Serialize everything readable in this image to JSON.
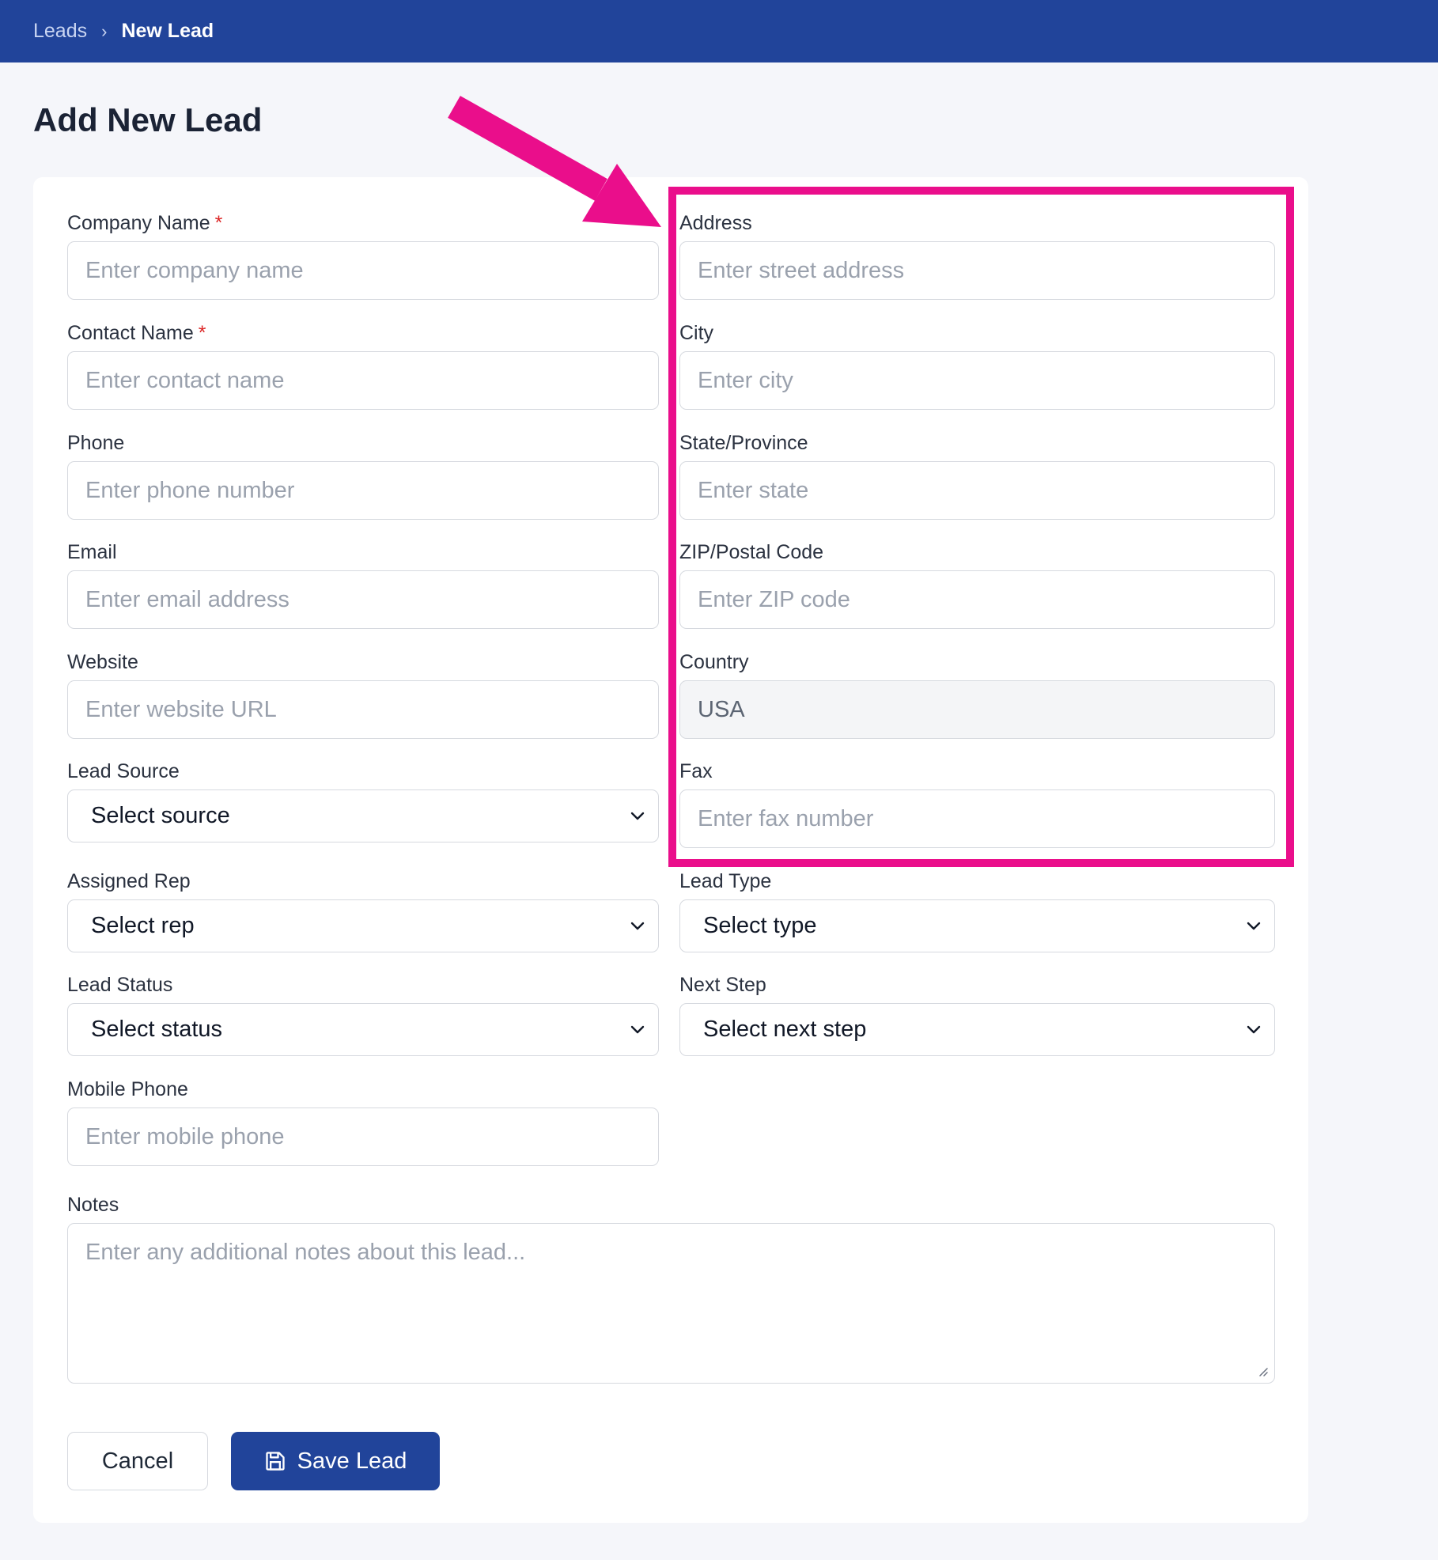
{
  "breadcrumb": {
    "parent": "Leads",
    "separator": "›",
    "current": "New Lead"
  },
  "page_title": "Add New Lead",
  "required_marker": "*",
  "left": {
    "company_name": {
      "label": "Company Name",
      "placeholder": "Enter company name"
    },
    "contact_name": {
      "label": "Contact Name",
      "placeholder": "Enter contact name"
    },
    "phone": {
      "label": "Phone",
      "placeholder": "Enter phone number"
    },
    "email": {
      "label": "Email",
      "placeholder": "Enter email address"
    },
    "website": {
      "label": "Website",
      "placeholder": "Enter website URL"
    },
    "lead_source": {
      "label": "Lead Source",
      "value": "Select source"
    },
    "assigned_rep": {
      "label": "Assigned Rep",
      "value": "Select rep"
    },
    "lead_status": {
      "label": "Lead Status",
      "value": "Select status"
    },
    "mobile_phone": {
      "label": "Mobile Phone",
      "placeholder": "Enter mobile phone"
    }
  },
  "right": {
    "address": {
      "label": "Address",
      "placeholder": "Enter street address"
    },
    "city": {
      "label": "City",
      "placeholder": "Enter city"
    },
    "state": {
      "label": "State/Province",
      "placeholder": "Enter state"
    },
    "zip": {
      "label": "ZIP/Postal Code",
      "placeholder": "Enter ZIP code"
    },
    "country": {
      "label": "Country",
      "value": "USA"
    },
    "fax": {
      "label": "Fax",
      "placeholder": "Enter fax number"
    },
    "lead_type": {
      "label": "Lead Type",
      "value": "Select type"
    },
    "next_step": {
      "label": "Next Step",
      "value": "Select next step"
    }
  },
  "notes": {
    "label": "Notes",
    "placeholder": "Enter any additional notes about this lead..."
  },
  "actions": {
    "cancel": "Cancel",
    "save": "Save Lead"
  },
  "colors": {
    "header": "#21449a",
    "primary": "#21449a",
    "highlight": "#ea0e8b",
    "required": "#dc2626"
  },
  "icons": {
    "save": "floppy-disk-icon",
    "select": "chevron-down-icon"
  }
}
